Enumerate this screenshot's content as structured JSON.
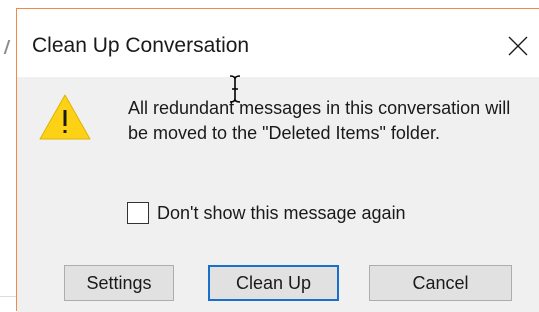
{
  "dialog": {
    "title": "Clean Up Conversation",
    "message": "All redundant messages in this conversation will be moved to the \"Deleted Items\" folder.",
    "checkbox_label": "Don't show this message again",
    "checkbox_checked": false,
    "buttons": {
      "settings": "Settings",
      "clean_up": "Clean Up",
      "cancel": "Cancel"
    },
    "icons": {
      "warning": "warning-icon",
      "close": "close-icon",
      "cursor": "text-cursor-icon"
    },
    "colors": {
      "window_border": "#f08a4c",
      "content_bg": "#f0f0f0",
      "default_button_border": "#1b6fcc",
      "warning_fill": "#fcd116"
    }
  }
}
